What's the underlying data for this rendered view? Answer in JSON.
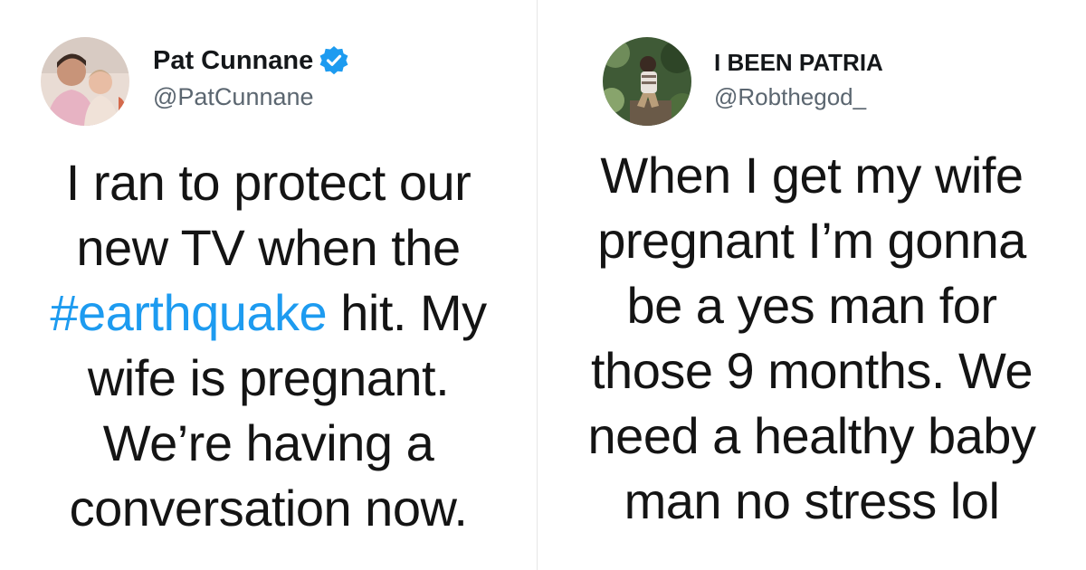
{
  "tweets": [
    {
      "author": {
        "display_name": "Pat Cunnane",
        "handle": "@PatCunnane",
        "verified": true,
        "avatar": "avatar-photo-man-with-baby"
      },
      "text": {
        "line1": "I ran to protect our",
        "line2": "new TV when the",
        "line3_hashtag": "#earthquake",
        "line3_rest": " hit. My",
        "line4": "wife is pregnant.",
        "line5": "We’re having a",
        "line6": "conversation now."
      }
    },
    {
      "author": {
        "display_name": "I BEEN PATRIA",
        "handle": "@Robthegod_",
        "verified": false,
        "avatar": "avatar-photo-man-outdoors"
      },
      "text": {
        "line1": "When I get my wife",
        "line2": "pregnant I’m gonna",
        "line3": "be a yes man for",
        "line4": "those 9 months. We",
        "line5": "need a healthy baby",
        "line6": "man no stress lol"
      }
    }
  ],
  "colors": {
    "hashtag": "#1d9bf0",
    "verified_badge": "#1d9bf0",
    "text": "#141414",
    "handle": "#5b6670",
    "divider": "#e7e7e7"
  }
}
